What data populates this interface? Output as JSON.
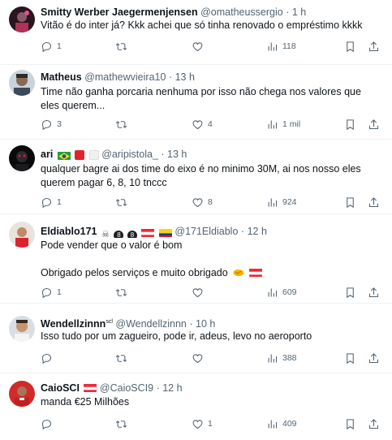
{
  "tweets": [
    {
      "name": "Smitty Werber Jaegermenjensen",
      "handle": "@omatheussergio",
      "time": "1 h",
      "text": "Vitão é do inter já? Kkk achei que só tinha renovado o empréstimo kkkk",
      "replies": "1",
      "retweets": "",
      "likes": "",
      "views": "118"
    },
    {
      "name": "Matheus",
      "handle": "@mathewvieira10",
      "time": "13 h",
      "text": "Time não ganha porcaria nenhuma por isso não chega nos valores que eles querem...",
      "replies": "3",
      "retweets": "",
      "likes": "4",
      "views": "1 mil"
    },
    {
      "name": "ari",
      "handle": "@aripistola_",
      "time": "13 h",
      "text": "qualquer bagre ai dos time do eixo é no minimo 30M, ai nos nosso eles querem pagar 6, 8, 10 tnccc",
      "replies": "1",
      "retweets": "",
      "likes": "8",
      "views": "924"
    },
    {
      "name": "Eldiablo171",
      "handle": "@171Eldiablo",
      "time": "12 h",
      "text1": "Pode vender que o valor é bom",
      "text2": "Obrigado pelos serviços e muito obrigado",
      "replies": "1",
      "retweets": "",
      "likes": "",
      "views": "609"
    },
    {
      "name": "Wendellzinnn",
      "name_sup": "scl",
      "handle": "@Wendellzinnn",
      "time": "10 h",
      "text": "Isso tudo por um zagueiro, pode ir, adeus, levo no aeroporto",
      "replies": "",
      "retweets": "",
      "likes": "",
      "views": "388"
    },
    {
      "name": "CaioSCI",
      "handle": "@CaioSCI9",
      "time": "12 h",
      "text": "manda €25 Milhões",
      "replies": "",
      "retweets": "",
      "likes": "1",
      "views": "409"
    }
  ],
  "dot": "·",
  "icons": {
    "reply": "reply-icon",
    "retweet": "retweet-icon",
    "like": "heart-icon",
    "views": "views-icon",
    "bookmark": "bookmark-icon",
    "share": "share-icon"
  },
  "colors": {
    "text": "#0f1419",
    "muted": "#536471",
    "border": "#eff3f4",
    "internacional_red": "#d9232e"
  }
}
